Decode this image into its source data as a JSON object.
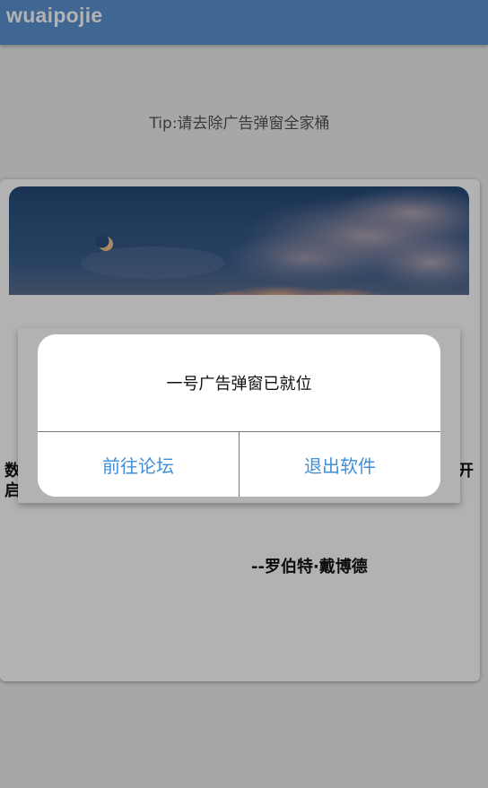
{
  "app_bar": {
    "title": "wuaipojie"
  },
  "tip": "Tip:请去除广告弹窗全家桶",
  "card": {
    "image_icon": "night-sky-moon-image",
    "quote_fragment_left_top": "数",
    "quote_fragment_left_bottom": "启",
    "quote_fragment_right_top": "开",
    "author": "--罗伯特·戴博德"
  },
  "dialog": {
    "message": "一号广告弹窗已就位",
    "buttons": {
      "goto_forum": "前往论坛",
      "exit_app": "退出软件"
    }
  },
  "colors": {
    "app_bar": "#5c93d3",
    "accent_text": "#3f8fdb",
    "scrim": "rgba(0,0,0,0.30)"
  }
}
